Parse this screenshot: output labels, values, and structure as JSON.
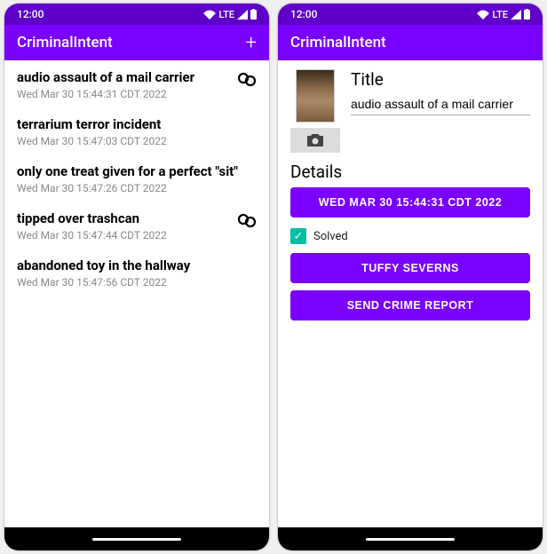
{
  "status": {
    "time": "12:00",
    "network": "LTE"
  },
  "appbar": {
    "title": "CriminalIntent",
    "add": "+"
  },
  "list": {
    "items": [
      {
        "title": "audio assault of a mail carrier",
        "date": "Wed Mar 30 15:44:31 CDT 2022",
        "solved": true
      },
      {
        "title": "terrarium terror incident",
        "date": "Wed Mar 30 15:47:03 CDT 2022",
        "solved": false
      },
      {
        "title": "only one treat given for a perfect \"sit\"",
        "date": "Wed Mar 30 15:47:26 CDT 2022",
        "solved": false
      },
      {
        "title": "tipped over trashcan",
        "date": "Wed Mar 30 15:47:44 CDT 2022",
        "solved": true
      },
      {
        "title": "abandoned toy in the hallway",
        "date": "Wed Mar 30 15:47:56 CDT 2022",
        "solved": false
      }
    ]
  },
  "detail": {
    "title_label": "Title",
    "title_value": "audio assault of a mail carrier",
    "details_label": "Details",
    "date_button": "WED MAR 30 15:44:31 CDT 2022",
    "solved_label": "Solved",
    "solved_checked": true,
    "suspect_button": "TUFFY SEVERNS",
    "report_button": "SEND CRIME REPORT"
  }
}
